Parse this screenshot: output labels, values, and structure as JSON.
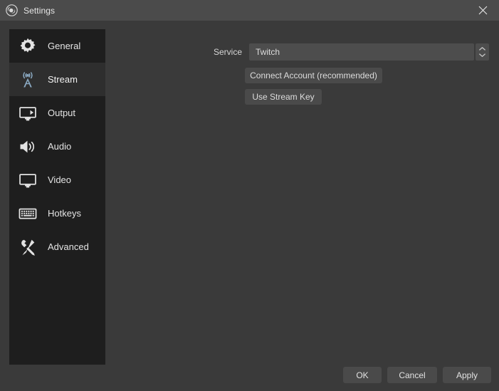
{
  "window": {
    "title": "Settings",
    "logo_icon": "obs-logo-icon",
    "close_icon": "close-icon"
  },
  "colors": {
    "titlebar_bg": "#4b4b4b",
    "dialog_bg": "#3a3a3a",
    "sidebar_bg": "#1e1e1e",
    "sidebar_selected_bg": "#2e2e2e",
    "control_bg": "#4a4a4a",
    "text": "#e2e2e2",
    "selected_icon": "#7f9fb8"
  },
  "sidebar": {
    "items": [
      {
        "label": "General",
        "icon": "gear-icon",
        "selected": false
      },
      {
        "label": "Stream",
        "icon": "broadcast-icon",
        "selected": true
      },
      {
        "label": "Output",
        "icon": "monitor-arrow-icon",
        "selected": false
      },
      {
        "label": "Audio",
        "icon": "speaker-icon",
        "selected": false
      },
      {
        "label": "Video",
        "icon": "display-icon",
        "selected": false
      },
      {
        "label": "Hotkeys",
        "icon": "keyboard-icon",
        "selected": false
      },
      {
        "label": "Advanced",
        "icon": "tools-icon",
        "selected": false
      }
    ]
  },
  "main": {
    "service": {
      "label": "Service",
      "value": "Twitch",
      "spinner_icon": "chevron-up-down-icon"
    },
    "connect_account_label": "Connect Account (recommended)",
    "use_stream_key_label": "Use Stream Key"
  },
  "footer": {
    "ok_label": "OK",
    "cancel_label": "Cancel",
    "apply_label": "Apply"
  }
}
